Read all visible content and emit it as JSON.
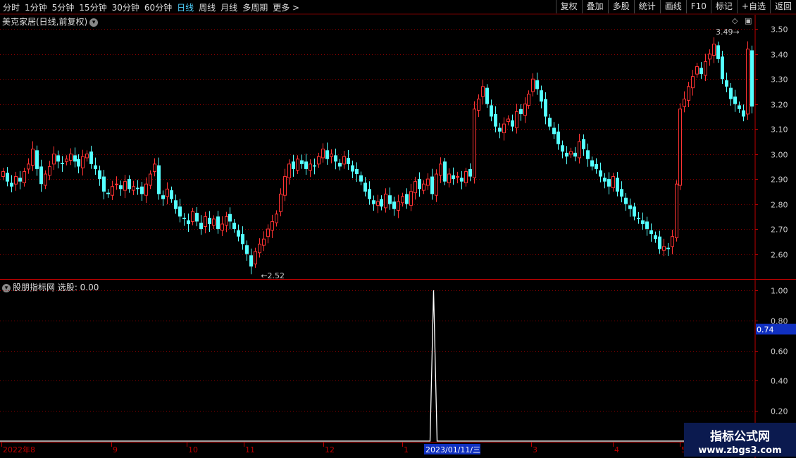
{
  "toolbar": {
    "periods": [
      "分时",
      "1分钟",
      "5分钟",
      "15分钟",
      "30分钟",
      "60分钟",
      "日线",
      "周线",
      "月线",
      "多周期",
      "更多 >"
    ],
    "active_period": "日线",
    "right_buttons": [
      "复权",
      "叠加",
      "多股",
      "统计",
      "画线",
      "F10",
      "标记",
      "+自选",
      "返回"
    ]
  },
  "main_title": "美克家居(日线,前复权)",
  "indicator_title": "股朋指标网 选股: 0.00",
  "watermark": {
    "line1": "指标公式网",
    "line2": "www.zbgs3.com"
  },
  "colors": {
    "up": "#ff3333",
    "down": "#54ffff",
    "grid": "#8b0000",
    "axis": "#c00000",
    "text": "#cccccc",
    "highlight": "#1030c0"
  },
  "chart_data": [
    {
      "type": "candlestick",
      "title": "美克家居(日线,前复权)",
      "ylim": [
        2.5,
        3.56
      ],
      "yticks": [
        2.6,
        2.7,
        2.8,
        2.9,
        3.0,
        3.1,
        3.2,
        3.3,
        3.4,
        3.5
      ],
      "ytick_labels": [
        "2.60",
        "2.70",
        "2.80",
        "2.90",
        "3.00",
        "3.10",
        "3.20",
        "3.30",
        "3.40",
        "3.50"
      ],
      "annotations": [
        {
          "text": "2.52",
          "value": 2.52,
          "kind": "low"
        },
        {
          "text": "3.49",
          "value": 3.49,
          "kind": "high"
        }
      ],
      "closes": [
        2.93,
        2.89,
        2.87,
        2.91,
        2.89,
        2.93,
        2.96,
        3.02,
        2.94,
        2.88,
        2.92,
        2.95,
        3.0,
        2.97,
        2.96,
        2.98,
        3.0,
        2.97,
        2.95,
        2.99,
        3.0,
        2.96,
        2.94,
        2.9,
        2.85,
        2.84,
        2.87,
        2.88,
        2.86,
        2.89,
        2.86,
        2.87,
        2.86,
        2.84,
        2.88,
        2.92,
        2.96,
        2.84,
        2.82,
        2.86,
        2.82,
        2.78,
        2.75,
        2.74,
        2.72,
        2.77,
        2.73,
        2.7,
        2.75,
        2.72,
        2.74,
        2.7,
        2.72,
        2.75,
        2.73,
        2.7,
        2.67,
        2.64,
        2.6,
        2.55,
        2.61,
        2.64,
        2.66,
        2.7,
        2.73,
        2.76,
        2.84,
        2.91,
        2.96,
        2.94,
        2.98,
        2.96,
        2.94,
        2.96,
        2.95,
        2.99,
        3.02,
        2.98,
        3.0,
        2.97,
        2.95,
        2.99,
        2.96,
        2.93,
        2.92,
        2.89,
        2.85,
        2.82,
        2.8,
        2.81,
        2.79,
        2.84,
        2.8,
        2.78,
        2.81,
        2.83,
        2.8,
        2.85,
        2.89,
        2.86,
        2.88,
        2.9,
        2.84,
        2.92,
        2.96,
        2.89,
        2.92,
        2.9,
        2.91,
        2.89,
        2.93,
        2.91,
        3.18,
        3.22,
        3.27,
        3.2,
        3.15,
        3.11,
        3.09,
        3.12,
        3.14,
        3.11,
        3.17,
        3.16,
        3.2,
        3.24,
        3.3,
        3.26,
        3.21,
        3.15,
        3.11,
        3.08,
        3.04,
        3.01,
        2.99,
        3.01,
        2.99,
        3.05,
        3.02,
        2.98,
        2.95,
        2.94,
        2.91,
        2.89,
        2.87,
        2.91,
        2.85,
        2.83,
        2.8,
        2.78,
        2.75,
        2.74,
        2.72,
        2.7,
        2.68,
        2.66,
        2.62,
        2.63,
        2.62,
        2.67,
        2.88,
        3.18,
        3.22,
        3.27,
        3.31,
        3.35,
        3.32,
        3.37,
        3.4,
        3.44,
        3.38,
        3.3,
        3.27,
        3.22,
        3.2,
        3.18,
        3.15,
        3.42,
        3.19
      ]
    },
    {
      "type": "line",
      "title": "股朋指标网 选股: 0.00",
      "ylim": [
        0.0,
        1.07
      ],
      "yticks": [
        0.2,
        0.4,
        0.6,
        0.8,
        1.0
      ],
      "ytick_labels": [
        "0.20",
        "0.40",
        "0.60",
        "0.80",
        "1.00"
      ],
      "current_value_label": "0.74",
      "series": [
        {
          "values_nonzero": [
            {
              "date": "2023/01/11/三",
              "value": 1.0
            }
          ],
          "baseline": 0.0
        }
      ]
    },
    {
      "type": "x-axis",
      "labels": [
        "2022年8",
        "9",
        "10",
        "11",
        "12",
        "1",
        "3",
        "4",
        "5"
      ],
      "highlight_label": "2023/01/11/三"
    }
  ]
}
